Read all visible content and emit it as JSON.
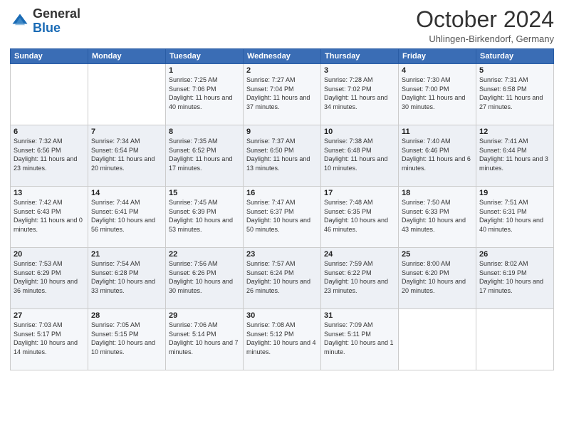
{
  "header": {
    "logo_general": "General",
    "logo_blue": "Blue",
    "month_title": "October 2024",
    "subtitle": "Uhlingen-Birkendorf, Germany"
  },
  "weekdays": [
    "Sunday",
    "Monday",
    "Tuesday",
    "Wednesday",
    "Thursday",
    "Friday",
    "Saturday"
  ],
  "weeks": [
    [
      {
        "day": "",
        "sunrise": "",
        "sunset": "",
        "daylight": ""
      },
      {
        "day": "",
        "sunrise": "",
        "sunset": "",
        "daylight": ""
      },
      {
        "day": "1",
        "sunrise": "Sunrise: 7:25 AM",
        "sunset": "Sunset: 7:06 PM",
        "daylight": "Daylight: 11 hours and 40 minutes."
      },
      {
        "day": "2",
        "sunrise": "Sunrise: 7:27 AM",
        "sunset": "Sunset: 7:04 PM",
        "daylight": "Daylight: 11 hours and 37 minutes."
      },
      {
        "day": "3",
        "sunrise": "Sunrise: 7:28 AM",
        "sunset": "Sunset: 7:02 PM",
        "daylight": "Daylight: 11 hours and 34 minutes."
      },
      {
        "day": "4",
        "sunrise": "Sunrise: 7:30 AM",
        "sunset": "Sunset: 7:00 PM",
        "daylight": "Daylight: 11 hours and 30 minutes."
      },
      {
        "day": "5",
        "sunrise": "Sunrise: 7:31 AM",
        "sunset": "Sunset: 6:58 PM",
        "daylight": "Daylight: 11 hours and 27 minutes."
      }
    ],
    [
      {
        "day": "6",
        "sunrise": "Sunrise: 7:32 AM",
        "sunset": "Sunset: 6:56 PM",
        "daylight": "Daylight: 11 hours and 23 minutes."
      },
      {
        "day": "7",
        "sunrise": "Sunrise: 7:34 AM",
        "sunset": "Sunset: 6:54 PM",
        "daylight": "Daylight: 11 hours and 20 minutes."
      },
      {
        "day": "8",
        "sunrise": "Sunrise: 7:35 AM",
        "sunset": "Sunset: 6:52 PM",
        "daylight": "Daylight: 11 hours and 17 minutes."
      },
      {
        "day": "9",
        "sunrise": "Sunrise: 7:37 AM",
        "sunset": "Sunset: 6:50 PM",
        "daylight": "Daylight: 11 hours and 13 minutes."
      },
      {
        "day": "10",
        "sunrise": "Sunrise: 7:38 AM",
        "sunset": "Sunset: 6:48 PM",
        "daylight": "Daylight: 11 hours and 10 minutes."
      },
      {
        "day": "11",
        "sunrise": "Sunrise: 7:40 AM",
        "sunset": "Sunset: 6:46 PM",
        "daylight": "Daylight: 11 hours and 6 minutes."
      },
      {
        "day": "12",
        "sunrise": "Sunrise: 7:41 AM",
        "sunset": "Sunset: 6:44 PM",
        "daylight": "Daylight: 11 hours and 3 minutes."
      }
    ],
    [
      {
        "day": "13",
        "sunrise": "Sunrise: 7:42 AM",
        "sunset": "Sunset: 6:43 PM",
        "daylight": "Daylight: 11 hours and 0 minutes."
      },
      {
        "day": "14",
        "sunrise": "Sunrise: 7:44 AM",
        "sunset": "Sunset: 6:41 PM",
        "daylight": "Daylight: 10 hours and 56 minutes."
      },
      {
        "day": "15",
        "sunrise": "Sunrise: 7:45 AM",
        "sunset": "Sunset: 6:39 PM",
        "daylight": "Daylight: 10 hours and 53 minutes."
      },
      {
        "day": "16",
        "sunrise": "Sunrise: 7:47 AM",
        "sunset": "Sunset: 6:37 PM",
        "daylight": "Daylight: 10 hours and 50 minutes."
      },
      {
        "day": "17",
        "sunrise": "Sunrise: 7:48 AM",
        "sunset": "Sunset: 6:35 PM",
        "daylight": "Daylight: 10 hours and 46 minutes."
      },
      {
        "day": "18",
        "sunrise": "Sunrise: 7:50 AM",
        "sunset": "Sunset: 6:33 PM",
        "daylight": "Daylight: 10 hours and 43 minutes."
      },
      {
        "day": "19",
        "sunrise": "Sunrise: 7:51 AM",
        "sunset": "Sunset: 6:31 PM",
        "daylight": "Daylight: 10 hours and 40 minutes."
      }
    ],
    [
      {
        "day": "20",
        "sunrise": "Sunrise: 7:53 AM",
        "sunset": "Sunset: 6:29 PM",
        "daylight": "Daylight: 10 hours and 36 minutes."
      },
      {
        "day": "21",
        "sunrise": "Sunrise: 7:54 AM",
        "sunset": "Sunset: 6:28 PM",
        "daylight": "Daylight: 10 hours and 33 minutes."
      },
      {
        "day": "22",
        "sunrise": "Sunrise: 7:56 AM",
        "sunset": "Sunset: 6:26 PM",
        "daylight": "Daylight: 10 hours and 30 minutes."
      },
      {
        "day": "23",
        "sunrise": "Sunrise: 7:57 AM",
        "sunset": "Sunset: 6:24 PM",
        "daylight": "Daylight: 10 hours and 26 minutes."
      },
      {
        "day": "24",
        "sunrise": "Sunrise: 7:59 AM",
        "sunset": "Sunset: 6:22 PM",
        "daylight": "Daylight: 10 hours and 23 minutes."
      },
      {
        "day": "25",
        "sunrise": "Sunrise: 8:00 AM",
        "sunset": "Sunset: 6:20 PM",
        "daylight": "Daylight: 10 hours and 20 minutes."
      },
      {
        "day": "26",
        "sunrise": "Sunrise: 8:02 AM",
        "sunset": "Sunset: 6:19 PM",
        "daylight": "Daylight: 10 hours and 17 minutes."
      }
    ],
    [
      {
        "day": "27",
        "sunrise": "Sunrise: 7:03 AM",
        "sunset": "Sunset: 5:17 PM",
        "daylight": "Daylight: 10 hours and 14 minutes."
      },
      {
        "day": "28",
        "sunrise": "Sunrise: 7:05 AM",
        "sunset": "Sunset: 5:15 PM",
        "daylight": "Daylight: 10 hours and 10 minutes."
      },
      {
        "day": "29",
        "sunrise": "Sunrise: 7:06 AM",
        "sunset": "Sunset: 5:14 PM",
        "daylight": "Daylight: 10 hours and 7 minutes."
      },
      {
        "day": "30",
        "sunrise": "Sunrise: 7:08 AM",
        "sunset": "Sunset: 5:12 PM",
        "daylight": "Daylight: 10 hours and 4 minutes."
      },
      {
        "day": "31",
        "sunrise": "Sunrise: 7:09 AM",
        "sunset": "Sunset: 5:11 PM",
        "daylight": "Daylight: 10 hours and 1 minute."
      },
      {
        "day": "",
        "sunrise": "",
        "sunset": "",
        "daylight": ""
      },
      {
        "day": "",
        "sunrise": "",
        "sunset": "",
        "daylight": ""
      }
    ]
  ]
}
